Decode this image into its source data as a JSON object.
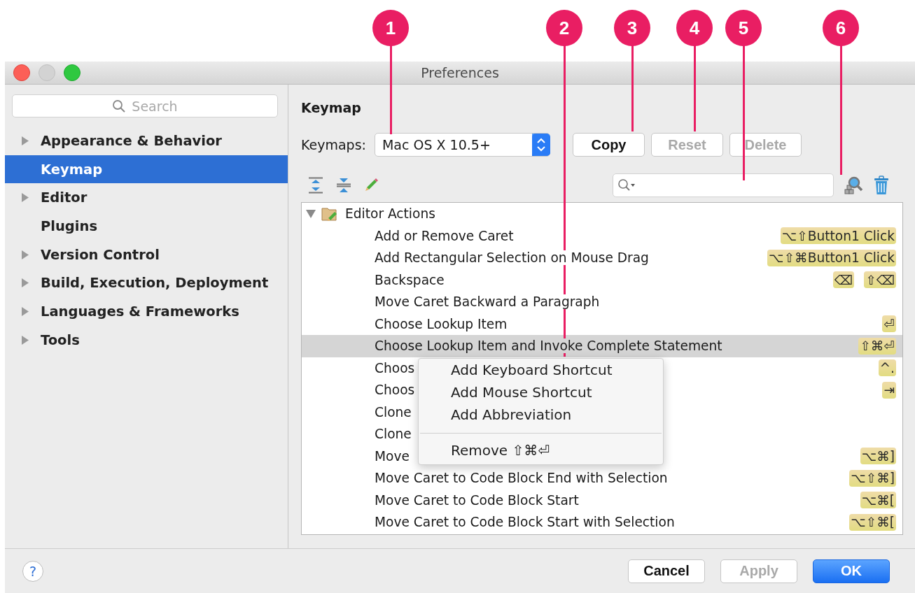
{
  "callouts": [
    {
      "label": "1"
    },
    {
      "label": "2"
    },
    {
      "label": "3"
    },
    {
      "label": "4"
    },
    {
      "label": "5"
    },
    {
      "label": "6"
    }
  ],
  "window": {
    "title": "Preferences"
  },
  "sidebar": {
    "search": {
      "placeholder": "Search"
    },
    "items": [
      {
        "label": "Appearance & Behavior",
        "expandable": true,
        "selected": false
      },
      {
        "label": "Keymap",
        "expandable": false,
        "selected": true
      },
      {
        "label": "Editor",
        "expandable": true,
        "selected": false
      },
      {
        "label": "Plugins",
        "expandable": false,
        "selected": false
      },
      {
        "label": "Version Control",
        "expandable": true,
        "selected": false
      },
      {
        "label": "Build, Execution, Deployment",
        "expandable": true,
        "selected": false
      },
      {
        "label": "Languages & Frameworks",
        "expandable": true,
        "selected": false
      },
      {
        "label": "Tools",
        "expandable": true,
        "selected": false
      }
    ]
  },
  "keymap": {
    "heading": "Keymap",
    "keymaps_label": "Keymaps:",
    "keymaps_value": "Mac OS X 10.5+",
    "buttons": [
      {
        "label": "Copy",
        "disabled": false
      },
      {
        "label": "Reset",
        "disabled": true
      },
      {
        "label": "Delete",
        "disabled": true
      }
    ]
  },
  "tree": [
    {
      "label": "Editor Actions",
      "expanded": true,
      "children": [
        {
          "label": "Add or Remove Caret",
          "shortcuts": [
            "⌥⇧Button1 Click"
          ],
          "selected": false
        },
        {
          "label": "Add Rectangular Selection on Mouse Drag",
          "shortcuts": [
            "⌥⇧⌘Button1 Click"
          ],
          "selected": false
        },
        {
          "label": "Backspace",
          "shortcuts": [
            "⌫",
            "⇧⌫"
          ],
          "selected": false
        },
        {
          "label": "Move Caret Backward a Paragraph",
          "selected": false
        },
        {
          "label": "Choose Lookup Item",
          "shortcuts": [
            "⏎"
          ],
          "selected": false
        },
        {
          "label": "Choose Lookup Item and Invoke Complete Statement",
          "shortcuts": [
            "⇧⌘⏎"
          ],
          "selected": true
        },
        {
          "label": "Choos",
          "shortcuts": [
            "^."
          ],
          "selected": false
        },
        {
          "label": "Choos",
          "shortcuts": [
            "⇥"
          ],
          "selected": false
        },
        {
          "label": "Clone",
          "selected": false
        },
        {
          "label": "Clone",
          "selected": false
        },
        {
          "label": "Move",
          "shortcuts": [
            "⌥⌘]"
          ],
          "selected": false
        },
        {
          "label": "Move Caret to Code Block End with Selection",
          "shortcuts": [
            "⌥⇧⌘]"
          ],
          "selected": false
        },
        {
          "label": "Move Caret to Code Block Start",
          "shortcuts": [
            "⌥⌘["
          ],
          "selected": false
        },
        {
          "label": "Move Caret to Code Block Start with Selection",
          "shortcuts": [
            "⌥⇧⌘["
          ],
          "selected": false
        }
      ]
    }
  ],
  "context_menu": {
    "items": [
      {
        "kind": "item",
        "label": "Add Keyboard Shortcut"
      },
      {
        "kind": "item",
        "label": "Add Mouse Shortcut"
      },
      {
        "kind": "item",
        "label": "Add Abbreviation"
      },
      {
        "kind": "separator"
      },
      {
        "kind": "item",
        "label": "Remove",
        "shortcut": "⇧⌘⏎"
      }
    ]
  },
  "footer": {
    "help": "?",
    "buttons": [
      {
        "label": "Cancel",
        "kind": "normal",
        "disabled": false
      },
      {
        "label": "Apply",
        "kind": "normal",
        "disabled": true
      },
      {
        "label": "OK",
        "kind": "default",
        "disabled": false
      }
    ]
  }
}
